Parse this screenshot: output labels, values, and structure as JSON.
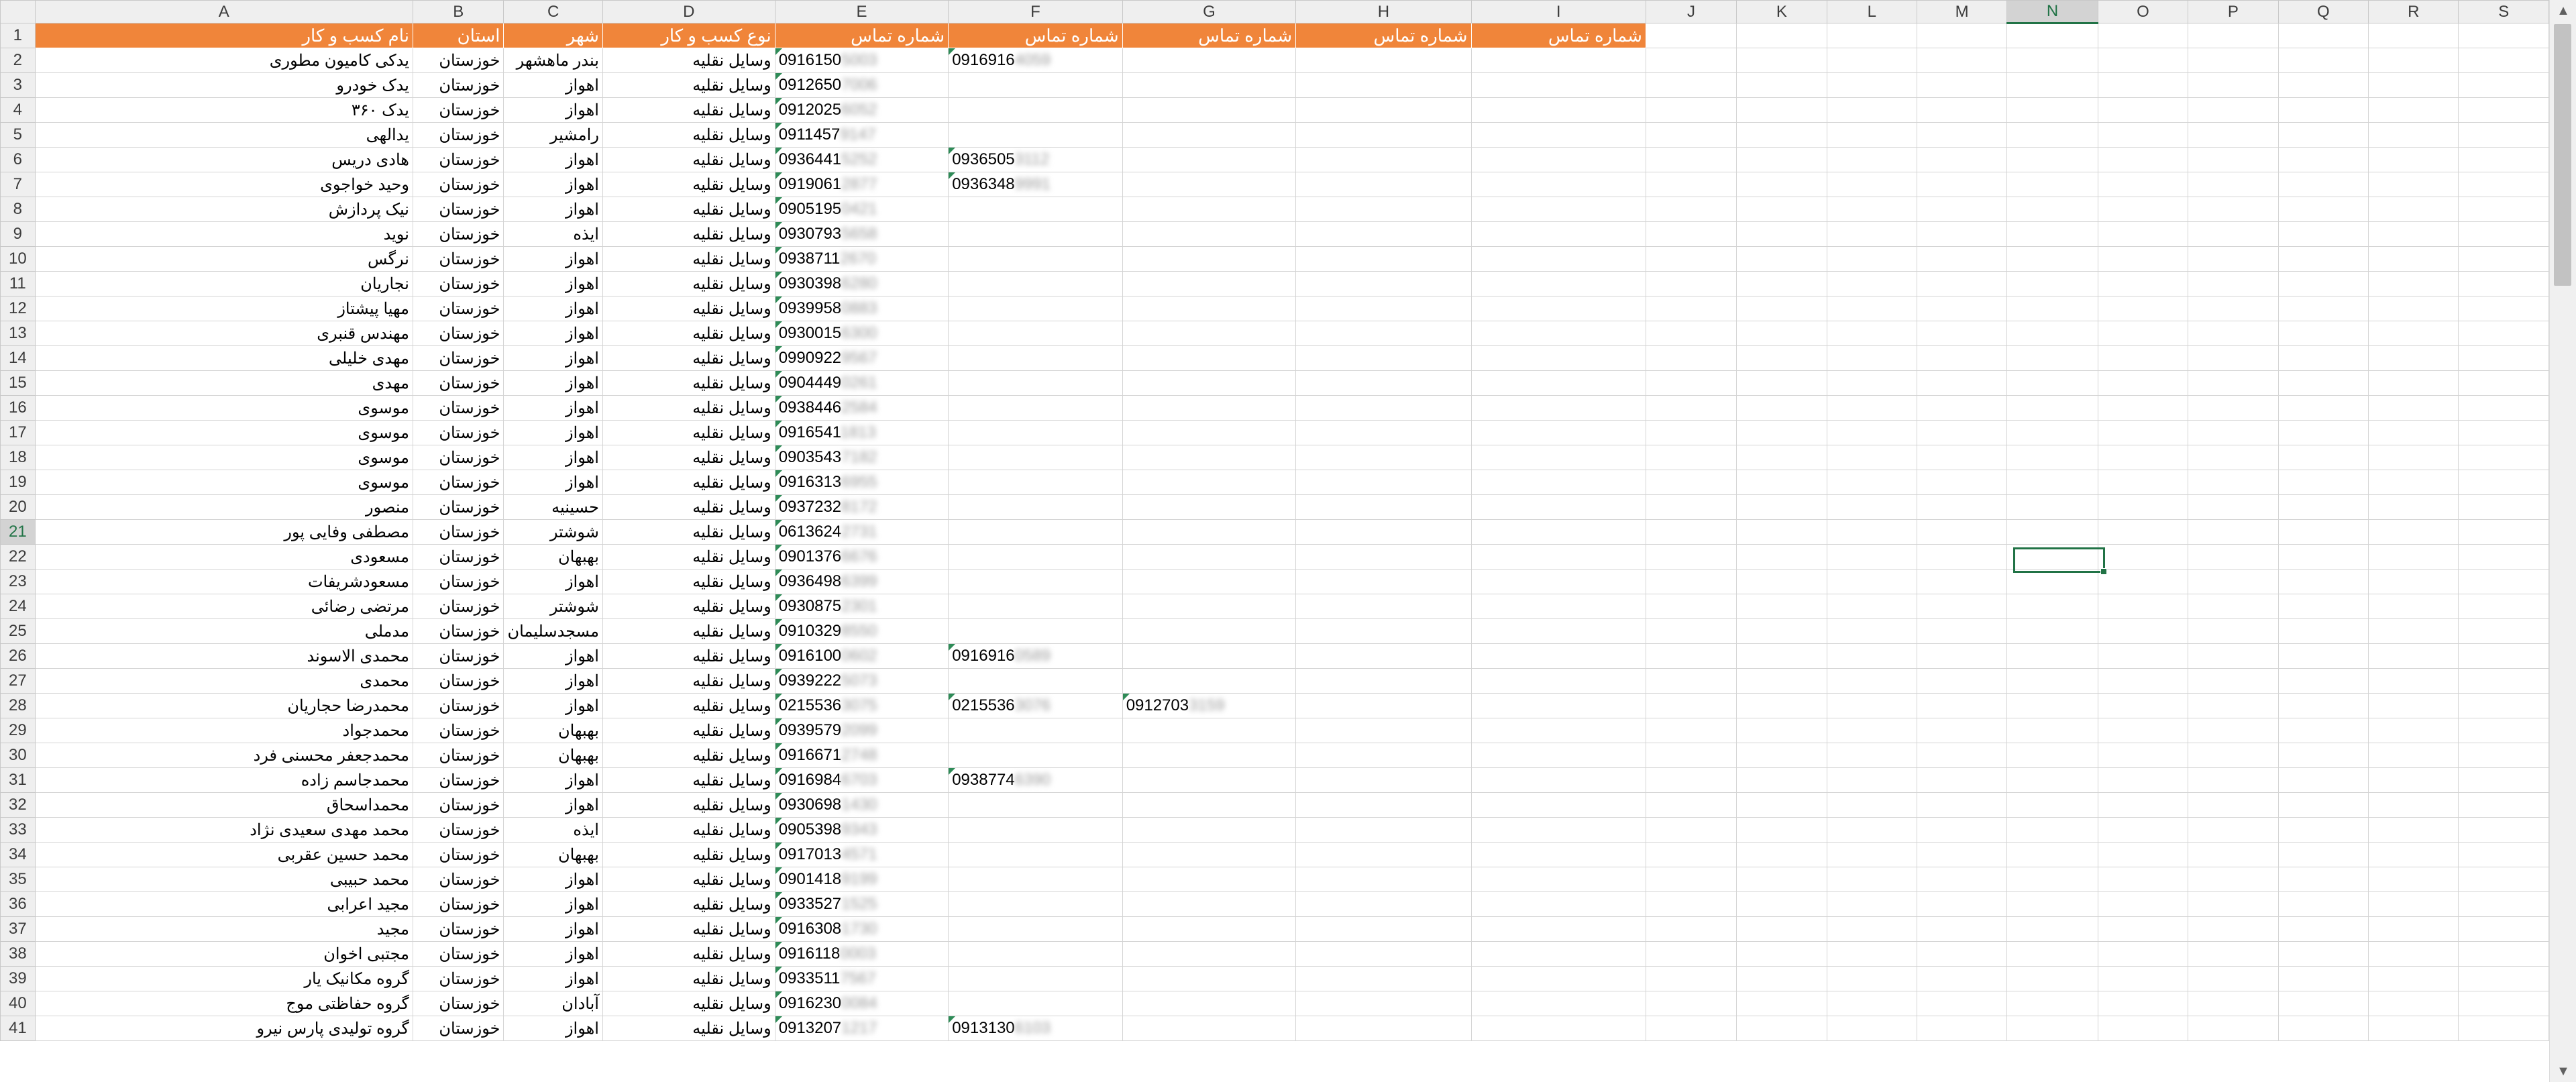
{
  "columns": [
    "A",
    "B",
    "C",
    "D",
    "E",
    "F",
    "G",
    "H",
    "I",
    "J",
    "K",
    "L",
    "M",
    "N",
    "O",
    "P",
    "Q",
    "R",
    "S"
  ],
  "selected_column": "N",
  "selected_row": "21",
  "header_row": [
    "نام کسب و کار",
    "استان",
    "شهر",
    "نوع کسب و کار",
    "شماره تماس",
    "شماره تماس",
    "شماره تماس",
    "شماره تماس",
    "شماره تماس"
  ],
  "rows": [
    {
      "n": "2",
      "a": "یدکی کامیون مطوری",
      "b": "خوزستان",
      "c": "بندر ماهشهر",
      "d": "وسایل نقلیه",
      "e": "0916150",
      "e_hidden": "5003",
      "f": "0916916",
      "f_hidden": "4059",
      "g": "",
      "g_hidden": ""
    },
    {
      "n": "3",
      "a": "یدک خودرو",
      "b": "خوزستان",
      "c": "اهواز",
      "d": "وسایل نقلیه",
      "e": "0912650",
      "e_hidden": "7006",
      "f": "",
      "f_hidden": "",
      "g": "",
      "g_hidden": ""
    },
    {
      "n": "4",
      "a": "یدک ۳۶۰",
      "b": "خوزستان",
      "c": "اهواز",
      "d": "وسایل نقلیه",
      "e": "0912025",
      "e_hidden": "6052",
      "f": "",
      "f_hidden": "",
      "g": "",
      "g_hidden": ""
    },
    {
      "n": "5",
      "a": "یدالهی",
      "b": "خوزستان",
      "c": "رامشیر",
      "d": "وسایل نقلیه",
      "e": "0911457",
      "e_hidden": "9147",
      "f": "",
      "f_hidden": "",
      "g": "",
      "g_hidden": ""
    },
    {
      "n": "6",
      "a": "هادی دریس",
      "b": "خوزستان",
      "c": "اهواز",
      "d": "وسایل نقلیه",
      "e": "0936441",
      "e_hidden": "5252",
      "f": "0936505",
      "f_hidden": "3112",
      "g": "",
      "g_hidden": ""
    },
    {
      "n": "7",
      "a": "وحید خواجوی",
      "b": "خوزستان",
      "c": "اهواز",
      "d": "وسایل نقلیه",
      "e": "0919061",
      "e_hidden": "2877",
      "f": "0936348",
      "f_hidden": "9991",
      "g": "",
      "g_hidden": ""
    },
    {
      "n": "8",
      "a": "نیک پردازش",
      "b": "خوزستان",
      "c": "اهواز",
      "d": "وسایل نقلیه",
      "e": "0905195",
      "e_hidden": "0421",
      "f": "",
      "f_hidden": "",
      "g": "",
      "g_hidden": ""
    },
    {
      "n": "9",
      "a": "نوید",
      "b": "خوزستان",
      "c": "ایذه",
      "d": "وسایل نقلیه",
      "e": "0930793",
      "e_hidden": "5658",
      "f": "",
      "f_hidden": "",
      "g": "",
      "g_hidden": ""
    },
    {
      "n": "10",
      "a": "نرگس",
      "b": "خوزستان",
      "c": "اهواز",
      "d": "وسایل نقلیه",
      "e": "0938711",
      "e_hidden": "2670",
      "f": "",
      "f_hidden": "",
      "g": "",
      "g_hidden": ""
    },
    {
      "n": "11",
      "a": "نجاریان",
      "b": "خوزستان",
      "c": "اهواز",
      "d": "وسایل نقلیه",
      "e": "0930398",
      "e_hidden": "6280",
      "f": "",
      "f_hidden": "",
      "g": "",
      "g_hidden": ""
    },
    {
      "n": "12",
      "a": "مهیا پیشتاز",
      "b": "خوزستان",
      "c": "اهواز",
      "d": "وسایل نقلیه",
      "e": "0939958",
      "e_hidden": "0883",
      "f": "",
      "f_hidden": "",
      "g": "",
      "g_hidden": ""
    },
    {
      "n": "13",
      "a": "مهندس قنبری",
      "b": "خوزستان",
      "c": "اهواز",
      "d": "وسایل نقلیه",
      "e": "0930015",
      "e_hidden": "6300",
      "f": "",
      "f_hidden": "",
      "g": "",
      "g_hidden": ""
    },
    {
      "n": "14",
      "a": "مهدی خلیلی",
      "b": "خوزستان",
      "c": "اهواز",
      "d": "وسایل نقلیه",
      "e": "0990922",
      "e_hidden": "9567",
      "f": "",
      "f_hidden": "",
      "g": "",
      "g_hidden": ""
    },
    {
      "n": "15",
      "a": "مهدی",
      "b": "خوزستان",
      "c": "اهواز",
      "d": "وسایل نقلیه",
      "e": "0904449",
      "e_hidden": "0261",
      "f": "",
      "f_hidden": "",
      "g": "",
      "g_hidden": ""
    },
    {
      "n": "16",
      "a": "موسوی",
      "b": "خوزستان",
      "c": "اهواز",
      "d": "وسایل نقلیه",
      "e": "0938446",
      "e_hidden": "2584",
      "f": "",
      "f_hidden": "",
      "g": "",
      "g_hidden": ""
    },
    {
      "n": "17",
      "a": "موسوی",
      "b": "خوزستان",
      "c": "اهواز",
      "d": "وسایل نقلیه",
      "e": "0916541",
      "e_hidden": "1813",
      "f": "",
      "f_hidden": "",
      "g": "",
      "g_hidden": ""
    },
    {
      "n": "18",
      "a": "موسوی",
      "b": "خوزستان",
      "c": "اهواز",
      "d": "وسایل نقلیه",
      "e": "0903543",
      "e_hidden": "7182",
      "f": "",
      "f_hidden": "",
      "g": "",
      "g_hidden": ""
    },
    {
      "n": "19",
      "a": "موسوی",
      "b": "خوزستان",
      "c": "اهواز",
      "d": "وسایل نقلیه",
      "e": "0916313",
      "e_hidden": "6955",
      "f": "",
      "f_hidden": "",
      "g": "",
      "g_hidden": ""
    },
    {
      "n": "20",
      "a": "منصور",
      "b": "خوزستان",
      "c": "حسینیه",
      "d": "وسایل نقلیه",
      "e": "0937232",
      "e_hidden": "8172",
      "f": "",
      "f_hidden": "",
      "g": "",
      "g_hidden": ""
    },
    {
      "n": "21",
      "a": "مصطفی وفایی پور",
      "b": "خوزستان",
      "c": "شوشتر",
      "d": "وسایل نقلیه",
      "e": "0613624",
      "e_hidden": "2731",
      "f": "",
      "f_hidden": "",
      "g": "",
      "g_hidden": ""
    },
    {
      "n": "22",
      "a": "مسعودی",
      "b": "خوزستان",
      "c": "بهبهان",
      "d": "وسایل نقلیه",
      "e": "0901376",
      "e_hidden": "6676",
      "f": "",
      "f_hidden": "",
      "g": "",
      "g_hidden": ""
    },
    {
      "n": "23",
      "a": "مسعودشریفات",
      "b": "خوزستان",
      "c": "اهواز",
      "d": "وسایل نقلیه",
      "e": "0936498",
      "e_hidden": "6399",
      "f": "",
      "f_hidden": "",
      "g": "",
      "g_hidden": ""
    },
    {
      "n": "24",
      "a": "مرتضی رضائی",
      "b": "خوزستان",
      "c": "شوشتر",
      "d": "وسایل نقلیه",
      "e": "0930875",
      "e_hidden": "2301",
      "f": "",
      "f_hidden": "",
      "g": "",
      "g_hidden": ""
    },
    {
      "n": "25",
      "a": "مدملی",
      "b": "خوزستان",
      "c": "مسجدسلیمان",
      "d": "وسایل نقلیه",
      "e": "0910329",
      "e_hidden": "8550",
      "f": "",
      "f_hidden": "",
      "g": "",
      "g_hidden": ""
    },
    {
      "n": "26",
      "a": "محمدی الاسوند",
      "b": "خوزستان",
      "c": "اهواز",
      "d": "وسایل نقلیه",
      "e": "0916100",
      "e_hidden": "0602",
      "f": "0916916",
      "f_hidden": "0589",
      "g": "",
      "g_hidden": ""
    },
    {
      "n": "27",
      "a": "محمدی",
      "b": "خوزستان",
      "c": "اهواز",
      "d": "وسایل نقلیه",
      "e": "0939222",
      "e_hidden": "5073",
      "f": "",
      "f_hidden": "",
      "g": "",
      "g_hidden": ""
    },
    {
      "n": "28",
      "a": "محمدرضا حجاریان",
      "b": "خوزستان",
      "c": "اهواز",
      "d": "وسایل نقلیه",
      "e": "0215536",
      "e_hidden": "3075",
      "f": "0215536",
      "f_hidden": "3076",
      "g": "0912703",
      "g_hidden": "3159"
    },
    {
      "n": "29",
      "a": "محمدجواد",
      "b": "خوزستان",
      "c": "بهبهان",
      "d": "وسایل نقلیه",
      "e": "0939579",
      "e_hidden": "2099",
      "f": "",
      "f_hidden": "",
      "g": "",
      "g_hidden": ""
    },
    {
      "n": "30",
      "a": "محمدجعفر محسنی فرد",
      "b": "خوزستان",
      "c": "بهبهان",
      "d": "وسایل نقلیه",
      "e": "0916671",
      "e_hidden": "2748",
      "f": "",
      "f_hidden": "",
      "g": "",
      "g_hidden": ""
    },
    {
      "n": "31",
      "a": "محمدجاسم زاده",
      "b": "خوزستان",
      "c": "اهواز",
      "d": "وسایل نقلیه",
      "e": "0916984",
      "e_hidden": "6703",
      "f": "0938774",
      "f_hidden": "6390",
      "g": "",
      "g_hidden": ""
    },
    {
      "n": "32",
      "a": "محمداسحاق",
      "b": "خوزستان",
      "c": "اهواز",
      "d": "وسایل نقلیه",
      "e": "0930698",
      "e_hidden": "1430",
      "f": "",
      "f_hidden": "",
      "g": "",
      "g_hidden": ""
    },
    {
      "n": "33",
      "a": "محمد مهدی سعیدی نژاد",
      "b": "خوزستان",
      "c": "ایذه",
      "d": "وسایل نقلیه",
      "e": "0905398",
      "e_hidden": "9343",
      "f": "",
      "f_hidden": "",
      "g": "",
      "g_hidden": ""
    },
    {
      "n": "34",
      "a": "محمد حسین عقربی",
      "b": "خوزستان",
      "c": "بهبهان",
      "d": "وسایل نقلیه",
      "e": "0917013",
      "e_hidden": "4571",
      "f": "",
      "f_hidden": "",
      "g": "",
      "g_hidden": ""
    },
    {
      "n": "35",
      "a": "محمد حبیبی",
      "b": "خوزستان",
      "c": "اهواز",
      "d": "وسایل نقلیه",
      "e": "0901418",
      "e_hidden": "9199",
      "f": "",
      "f_hidden": "",
      "g": "",
      "g_hidden": ""
    },
    {
      "n": "36",
      "a": "مجید اعرابی",
      "b": "خوزستان",
      "c": "اهواز",
      "d": "وسایل نقلیه",
      "e": "0933527",
      "e_hidden": "1525",
      "f": "",
      "f_hidden": "",
      "g": "",
      "g_hidden": ""
    },
    {
      "n": "37",
      "a": "مجید",
      "b": "خوزستان",
      "c": "اهواز",
      "d": "وسایل نقلیه",
      "e": "0916308",
      "e_hidden": "1730",
      "f": "",
      "f_hidden": "",
      "g": "",
      "g_hidden": ""
    },
    {
      "n": "38",
      "a": "مجتبی اخوان",
      "b": "خوزستان",
      "c": "اهواز",
      "d": "وسایل نقلیه",
      "e": "0916118",
      "e_hidden": "0003",
      "f": "",
      "f_hidden": "",
      "g": "",
      "g_hidden": ""
    },
    {
      "n": "39",
      "a": "گروه مکانیک یار",
      "b": "خوزستان",
      "c": "اهواز",
      "d": "وسایل نقلیه",
      "e": "0933511",
      "e_hidden": "7567",
      "f": "",
      "f_hidden": "",
      "g": "",
      "g_hidden": ""
    },
    {
      "n": "40",
      "a": "گروه حفاظتی موج",
      "b": "خوزستان",
      "c": "آبادان",
      "d": "وسایل نقلیه",
      "e": "0916230",
      "e_hidden": "0084",
      "f": "",
      "f_hidden": "",
      "g": "",
      "g_hidden": ""
    },
    {
      "n": "41",
      "a": "گروه تولیدی پارس نیرو",
      "b": "خوزستان",
      "c": "اهواز",
      "d": "وسایل نقلیه",
      "e": "0913207",
      "e_hidden": "1217",
      "f": "0913130",
      "f_hidden": "6103",
      "g": "",
      "g_hidden": ""
    }
  ]
}
